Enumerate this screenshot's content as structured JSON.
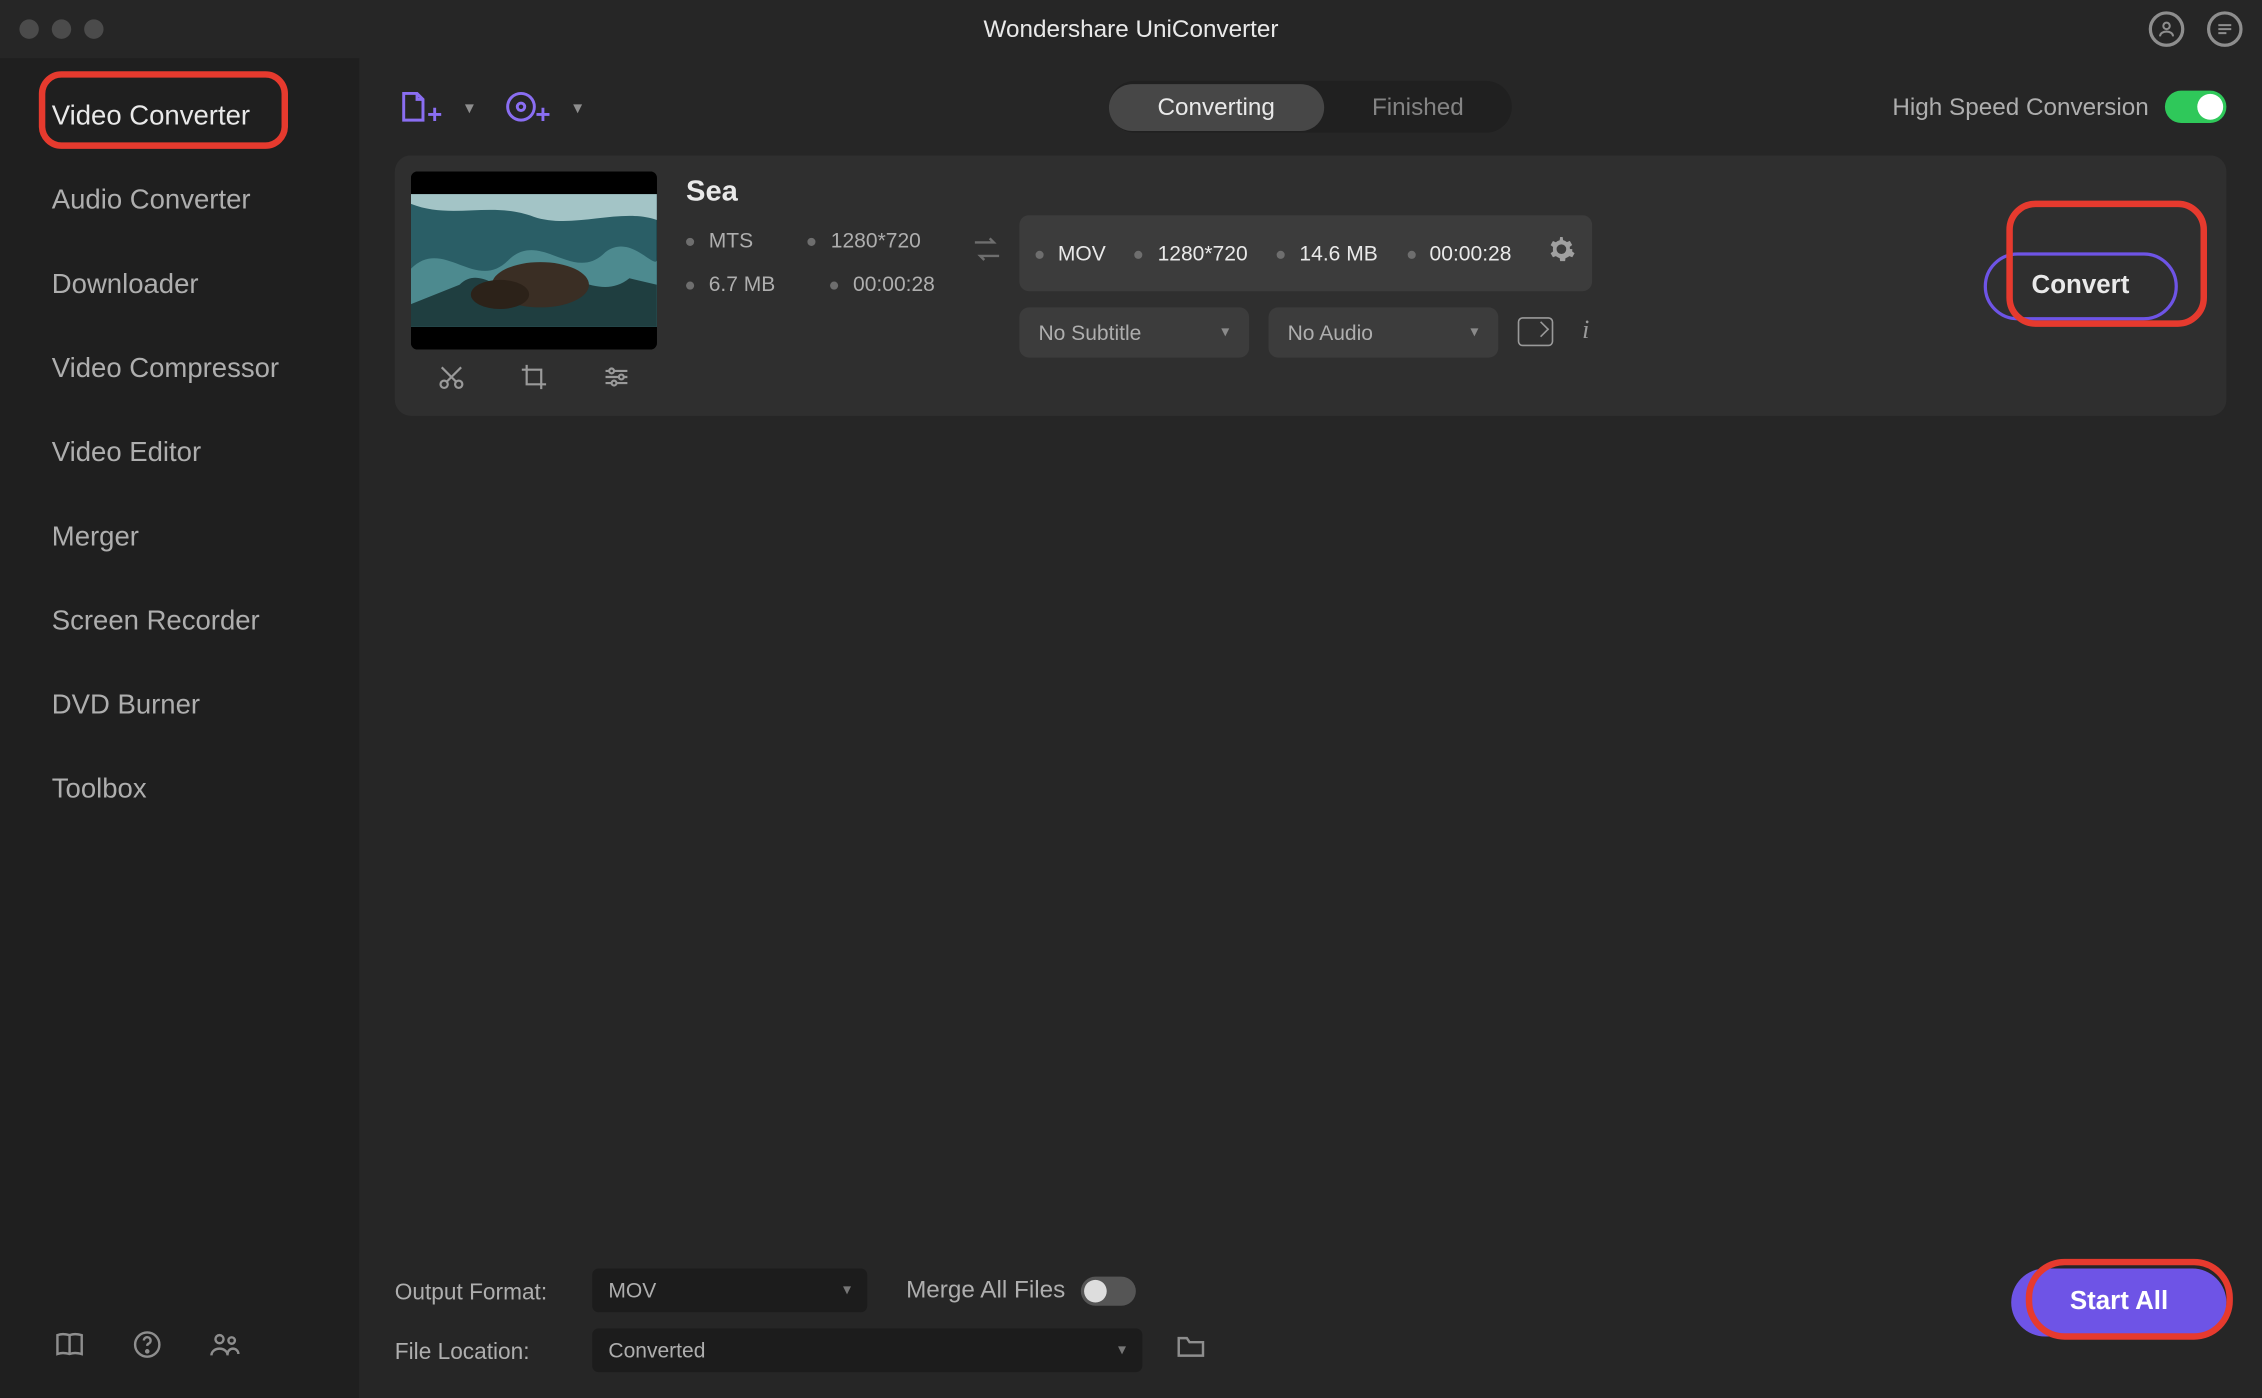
{
  "window": {
    "title": "Wondershare UniConverter"
  },
  "titlebar_icons": {
    "account": "account-icon",
    "feedback": "feedback-icon"
  },
  "sidebar": {
    "items": [
      {
        "label": "Video Converter",
        "active": true
      },
      {
        "label": "Audio Converter"
      },
      {
        "label": "Downloader"
      },
      {
        "label": "Video Compressor"
      },
      {
        "label": "Video Editor"
      },
      {
        "label": "Merger"
      },
      {
        "label": "Screen Recorder"
      },
      {
        "label": "DVD Burner"
      },
      {
        "label": "Toolbox"
      }
    ],
    "bottom_icons": [
      "book-icon",
      "help-icon",
      "community-icon"
    ]
  },
  "toolbar": {
    "add_file_name": "add-file-icon",
    "add_dvd_name": "add-dvd-icon",
    "tabs": {
      "converting": "Converting",
      "finished": "Finished",
      "active": "converting"
    },
    "high_speed_label": "High Speed Conversion",
    "high_speed_on": true
  },
  "file": {
    "name": "Sea",
    "source": {
      "format": "MTS",
      "resolution": "1280*720",
      "size": "6.7 MB",
      "duration": "00:00:28"
    },
    "target": {
      "format": "MOV",
      "resolution": "1280*720",
      "size": "14.6 MB",
      "duration": "00:00:28"
    },
    "thumb_tools": [
      "trim-icon",
      "crop-icon",
      "adjust-icon"
    ],
    "subtitle_label": "No Subtitle",
    "audio_label": "No Audio",
    "convert_label": "Convert"
  },
  "bottom": {
    "output_format_label": "Output Format:",
    "output_format_value": "MOV",
    "merge_label": "Merge All Files",
    "merge_on": false,
    "file_location_label": "File Location:",
    "file_location_value": "Converted",
    "start_all_label": "Start All"
  }
}
